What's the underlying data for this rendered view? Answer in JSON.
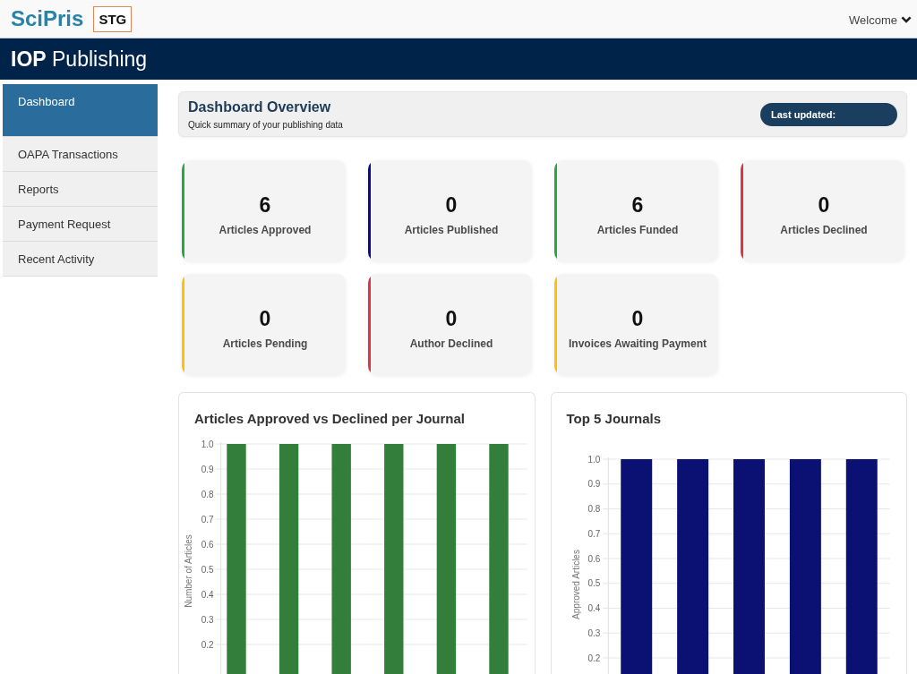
{
  "header": {
    "logo": "SciPris",
    "environment_badge": "STG",
    "user_menu": "Welcome"
  },
  "banner": {
    "publisher": "**IOP** Publishing"
  },
  "sidebar": {
    "items": [
      {
        "label": "Dashboard",
        "selected": true
      },
      {
        "label": "OAPA Transactions",
        "selected": false
      },
      {
        "label": "Reports",
        "selected": false
      },
      {
        "label": "Payment Request",
        "selected": false
      },
      {
        "label": "Recent Activity",
        "selected": false
      }
    ]
  },
  "overview": {
    "title": "Dashboard Overview",
    "subtitle": "Quick summary of your publishing data",
    "last_updated": "Last updated:"
  },
  "stats": [
    {
      "value": "6",
      "label": "Articles Approved",
      "color": "#28a745"
    },
    {
      "value": "0",
      "label": "Articles Published",
      "color": "#0a0a96"
    },
    {
      "value": "6",
      "label": "Articles Funded",
      "color": "#28a745"
    },
    {
      "value": "0",
      "label": "Articles Declined",
      "color": "#dc3545"
    },
    {
      "value": "0",
      "label": "Articles Pending",
      "color": "#ffc107"
    },
    {
      "value": "0",
      "label": "Author Declined",
      "color": "#dc3545"
    },
    {
      "value": "0",
      "label": "Invoices Awaiting Payment",
      "color": "#ffc107"
    }
  ],
  "charts": [
    {
      "chart_data": {
        "type": "bar",
        "title": "Articles Approved vs Declined per Journal",
        "ylabel": "Number of Articles",
        "ylim": [
          0.082,
          1
        ],
        "yticks": [
          0.2,
          0.3,
          0.4,
          0.5,
          0.6,
          0.7,
          0.8,
          0.9,
          {
            "value": 1,
            "label": "1.0"
          }
        ],
        "grid": true,
        "series": [
          {
            "color": "#337e3a",
            "values": [
              1,
              1,
              1,
              1,
              1,
              1
            ]
          }
        ]
      }
    },
    {
      "chart_data": {
        "type": "bar",
        "title": "Top 5 Journals",
        "ylabel": "Approved Articles",
        "ylim": [
          0.135,
          1
        ],
        "yticks": [
          0.2,
          0.3,
          0.4,
          0.5,
          0.6,
          0.7,
          0.8,
          0.9,
          {
            "value": 1,
            "label": "1.0"
          }
        ],
        "grid": true,
        "series": [
          {
            "color": "#0a1172",
            "values": [
              1,
              1,
              1,
              1,
              1
            ]
          }
        ]
      }
    }
  ]
}
